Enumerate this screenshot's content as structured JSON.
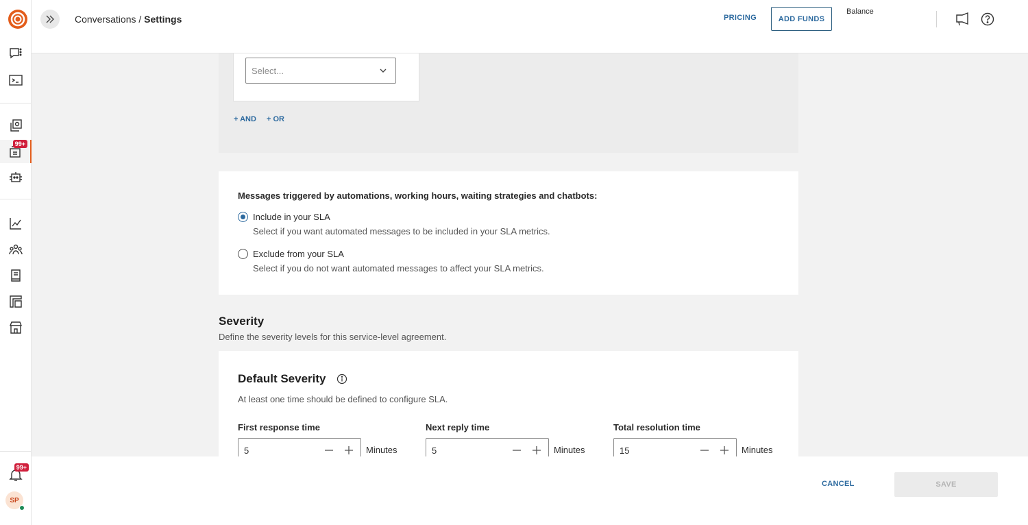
{
  "header": {
    "breadcrumb_parent": "Conversations",
    "breadcrumb_sep": " / ",
    "breadcrumb_current": "Settings",
    "pricing_label": "PRICING",
    "add_funds_label": "ADD FUNDS",
    "balance_label": "Balance"
  },
  "sidebar": {
    "badge_inbox": "99+",
    "badge_notifications": "99+",
    "avatar_initials": "SP",
    "accent_color": "#e35d1b"
  },
  "filters": {
    "select_placeholder": "Select...",
    "and_label": "+ AND",
    "or_label": "+ OR"
  },
  "automated_messages": {
    "question": "Messages triggered by automations, working hours, waiting strategies and chatbots:",
    "options": [
      {
        "title": "Include in your SLA",
        "description": "Select if you want automated messages to be included in your SLA metrics.",
        "checked": true
      },
      {
        "title": "Exclude from your SLA",
        "description": "Select if you do not want automated messages to affect your SLA metrics.",
        "checked": false
      }
    ]
  },
  "severity": {
    "title": "Severity",
    "description": "Define the severity levels for this service-level agreement.",
    "default_title": "Default Severity",
    "default_description": "At least one time should be defined to configure SLA.",
    "fields": [
      {
        "label": "First response time",
        "value": "5",
        "unit": "Minutes"
      },
      {
        "label": "Next reply time",
        "value": "5",
        "unit": "Minutes"
      },
      {
        "label": "Total resolution time",
        "value": "15",
        "unit": "Minutes"
      }
    ]
  },
  "footer": {
    "cancel_label": "CANCEL",
    "save_label": "SAVE"
  }
}
